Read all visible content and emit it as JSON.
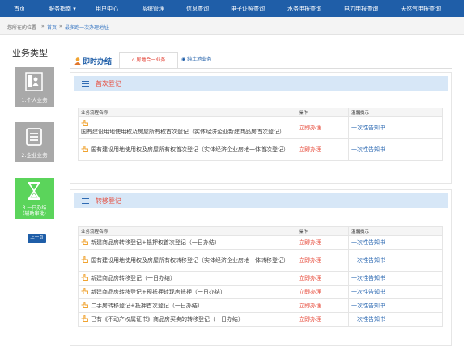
{
  "nav": {
    "items": [
      "首页",
      "服务指南",
      "用户中心",
      "系统管理",
      "信息查询",
      "电子证照查询",
      "水务申报查询",
      "电力申报查询",
      "天然气申报查询"
    ]
  },
  "breadcrumb": {
    "prefix": "您所在的位置",
    "home": "首页",
    "current": "最多跑一次办理地址"
  },
  "sidebar": {
    "title": "业务类型",
    "tiles": [
      {
        "label": "1.个人业务"
      },
      {
        "label": "2.企业业务"
      },
      {
        "label_line1": "3.一日办结",
        "label_line2": "（辅助审批）"
      }
    ],
    "prev_button": "上一页"
  },
  "tabs": {
    "main": "即时办结",
    "active": "房地合一业务",
    "other": "纯土地业务"
  },
  "sections": [
    {
      "title": "首次登记",
      "headers": [
        "业务流程名称",
        "操作",
        "温馨提示"
      ],
      "rows": [
        {
          "name": "国有建设用地使用权及房屋所有权首次登记（实体经济企业新建商品房首次登记）",
          "action": "立即办理",
          "tip": "一次性告知书"
        },
        {
          "name": "国有建设用地使用权及房屋所有权首次登记（实体经济企业房地一体首次登记）",
          "action": "立即办理",
          "tip": "一次性告知书"
        }
      ]
    },
    {
      "title": "转移登记",
      "headers": [
        "业务流程名称",
        "操作",
        "温馨提示"
      ],
      "rows": [
        {
          "name": "新建商品房转移登记+抵押权首次登记（一日办结）",
          "action": "立即办理",
          "tip": "一次性告知书"
        },
        {
          "name": "国有建设用地使用权及房屋所有权转移登记（实体经济企业房地一体转移登记）",
          "action": "立即办理",
          "tip": "一次性告知书"
        },
        {
          "name": "新建商品房转移登记（一日办结）",
          "action": "立即办理",
          "tip": "一次性告知书"
        },
        {
          "name": "新建商品房转移登记+预抵押转现房抵押（一日办结）",
          "action": "立即办理",
          "tip": "一次性告知书"
        },
        {
          "name": "二手房转移登记+抵押首次登记（一日办结）",
          "action": "立即办理",
          "tip": "一次性告知书"
        },
        {
          "name": "已有《不动产权属证书》商品房买卖的转移登记（一日办结）",
          "action": "立即办理",
          "tip": "一次性告知书"
        }
      ]
    }
  ]
}
